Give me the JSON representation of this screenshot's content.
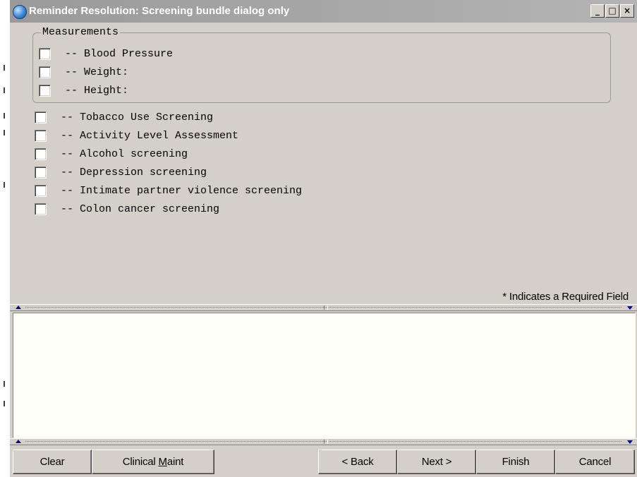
{
  "window": {
    "title": "Reminder Resolution: Screening bundle dialog only",
    "controls": {
      "minimize": "_",
      "maximize": "□",
      "close": "×"
    }
  },
  "measurements": {
    "legend": "Measurements",
    "items": [
      {
        "label": "-- Blood Pressure",
        "checked": false
      },
      {
        "label": "-- Weight:",
        "checked": false
      },
      {
        "label": "-- Height:",
        "checked": false
      }
    ]
  },
  "screenings": [
    {
      "label": "-- Tobacco Use Screening",
      "checked": false
    },
    {
      "label": "-- Activity Level Assessment",
      "checked": false
    },
    {
      "label": "-- Alcohol screening",
      "checked": false
    },
    {
      "label": "-- Depression screening",
      "checked": false
    },
    {
      "label": "-- Intimate partner violence screening",
      "checked": false
    },
    {
      "label": "-- Colon cancer screening",
      "checked": false
    }
  ],
  "required_note": "* Indicates a Required Field",
  "text_area": {
    "value": ""
  },
  "buttons": {
    "clear": "Clear",
    "clinical_maint_pre": "Clinical ",
    "clinical_maint_ul": "M",
    "clinical_maint_post": "aint",
    "back": "< Back",
    "next": "Next >",
    "finish": "Finish",
    "cancel": "Cancel"
  },
  "colors": {
    "face": "#d4d0c8",
    "title_bar": "#a8a8a8",
    "text_area_bg": "#fffff6",
    "splitter_arrow": "#000080"
  }
}
